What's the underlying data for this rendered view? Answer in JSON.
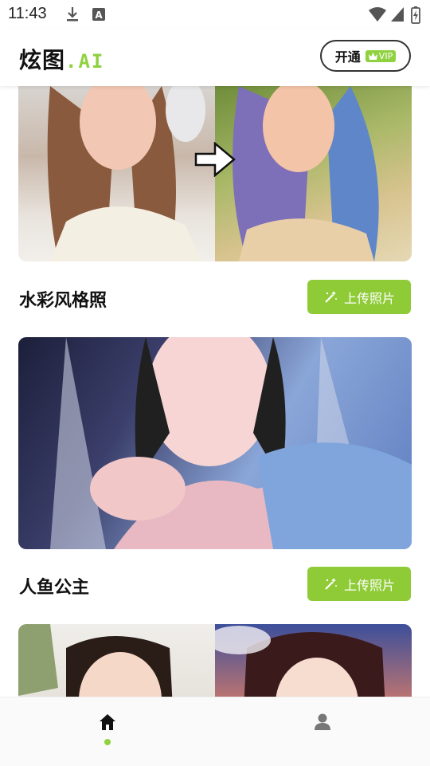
{
  "status": {
    "time": "11:43"
  },
  "header": {
    "logo_main": "炫图",
    "logo_ai": ".AI",
    "vip_label": "开通",
    "vip_badge": "VIP"
  },
  "sections": [
    {
      "title": "水彩风格照",
      "button": "上传照片"
    },
    {
      "title": "人鱼公主",
      "button": "上传照片"
    }
  ],
  "colors": {
    "accent": "#8fd13f",
    "button": "#8fcb37",
    "text": "#111111"
  },
  "nav": {
    "items": [
      {
        "icon": "home-icon",
        "active": true
      },
      {
        "icon": "profile-icon",
        "active": false
      }
    ]
  }
}
